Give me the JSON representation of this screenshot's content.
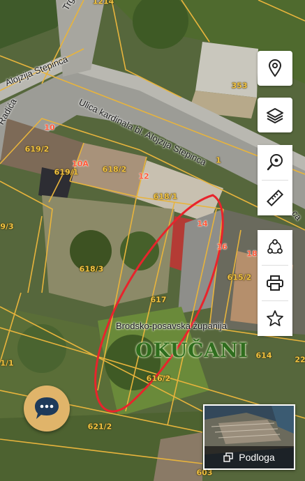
{
  "streets": {
    "trg": "Trg",
    "alojzija_stepinca": "Alojzija Stepinca",
    "radica": "Radića",
    "kardinala": "Ulica kardinala bl. Alojzija Stepinca",
    "ca_edge": "ca"
  },
  "parcels": {
    "p1214": "1214",
    "p353": "353",
    "p619_2": "619/2",
    "p619_1": "619/1",
    "p618_2": "618/2",
    "p618_1": "618/1",
    "p9_3": "9/3",
    "p618_3": "618/3",
    "p617": "617",
    "p616_2": "616/2",
    "p615_2": "615/2",
    "p614": "614",
    "p1_1": "1/1",
    "p621_2": "621/2",
    "p603": "603",
    "p22": "22",
    "p1_edge": "1",
    "p1_top": "1"
  },
  "house_numbers": {
    "h10": "10",
    "h10a": "10A",
    "h12": "12",
    "h14": "14",
    "h16": "16",
    "h18": "18"
  },
  "region": "Brodsko-posavska županija",
  "town": "OKUČANI",
  "toolbar": {
    "location": "location-pin-icon",
    "layers": "layers-icon",
    "search_location": "search-location-icon",
    "measure": "ruler-icon",
    "share": "share-nodes-icon",
    "print": "print-icon",
    "favorite": "star-icon"
  },
  "chat_icon": "chat-bubble-icon",
  "basemap": {
    "label": "Podloga",
    "icon": "basemap-toggle-icon"
  },
  "colors": {
    "parcel_line": "#e8b43c",
    "highlight": "#e8242c",
    "town": "#2f6d1e"
  }
}
